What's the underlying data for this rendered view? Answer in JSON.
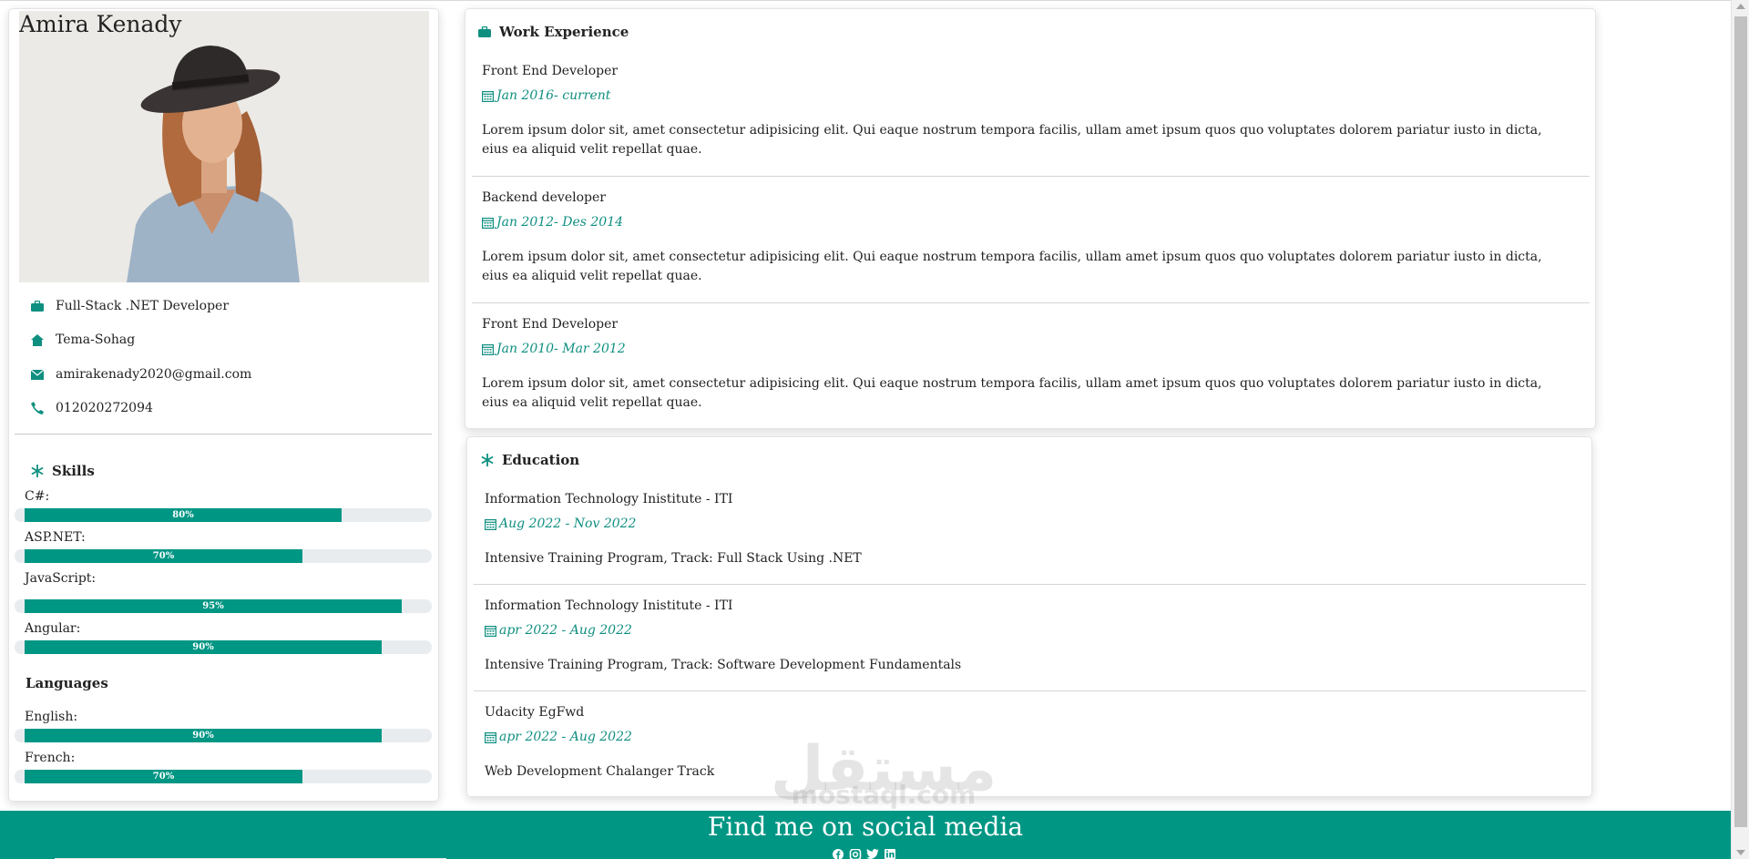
{
  "profile": {
    "name": "Amira Kenady",
    "job": "Full-Stack .NET Developer",
    "location": "Tema-Sohag",
    "email": "amirakenady2020@gmail.com",
    "phone": "012020272094"
  },
  "skills": {
    "title": "Skills",
    "items": [
      {
        "label": "C#:",
        "percent_text": "80%",
        "level": 80
      },
      {
        "label": "ASP.NET:",
        "percent_text": "70%",
        "level": 70
      },
      {
        "label": "JavaScript:",
        "percent_text": "95%",
        "level": 95
      },
      {
        "label": "Angular:",
        "percent_text": "90%",
        "level": 90
      }
    ]
  },
  "languages": {
    "title": "Languages",
    "items": [
      {
        "label": "English:",
        "percent_text": "90%",
        "level": 90
      },
      {
        "label": "French:",
        "percent_text": "70%",
        "level": 70
      }
    ]
  },
  "work": {
    "title": "Work Experience",
    "items": [
      {
        "title": "Front End Developer",
        "date": "Jan 2016- current",
        "desc": "Lorem ipsum dolor sit, amet consectetur adipisicing elit. Qui eaque nostrum tempora facilis, ullam amet ipsum quos quo voluptates dolorem pariatur iusto in dicta, eius ea aliquid velit repellat quae."
      },
      {
        "title": "Backend developer",
        "date": "Jan 2012- Des 2014",
        "desc": "Lorem ipsum dolor sit, amet consectetur adipisicing elit. Qui eaque nostrum tempora facilis, ullam amet ipsum quos quo voluptates dolorem pariatur iusto in dicta, eius ea aliquid velit repellat quae."
      },
      {
        "title": "Front End Developer",
        "date": "Jan 2010- Mar 2012",
        "desc": "Lorem ipsum dolor sit, amet consectetur adipisicing elit. Qui eaque nostrum tempora facilis, ullam amet ipsum quos quo voluptates dolorem pariatur iusto in dicta, eius ea aliquid velit repellat quae."
      }
    ]
  },
  "education": {
    "title": "Education",
    "items": [
      {
        "title": "Information Technology Inistitute - ITI",
        "date": "Aug 2022 - Nov 2022",
        "desc": "Intensive Training Program, Track: Full Stack Using .NET"
      },
      {
        "title": "Information Technology Inistitute - ITI",
        "date": "apr 2022 - Aug 2022",
        "desc": "Intensive Training Program, Track: Software Development Fundamentals"
      },
      {
        "title": "Udacity EgFwd",
        "date": "apr 2022 - Aug 2022",
        "desc": "Web Development Chalanger Track"
      }
    ]
  },
  "footer": {
    "title": "Find me on social media"
  },
  "watermark": {
    "arabic": "مستقل",
    "latin": "mostaql.com"
  },
  "colors": {
    "accent": "#009684",
    "accent_text": "#0f8f80"
  },
  "icons": {
    "job": "briefcase-icon",
    "location": "home-icon",
    "email": "envelope-icon",
    "phone": "phone-icon",
    "skills": "asterisk-icon",
    "work": "briefcase-icon",
    "education": "asterisk-icon",
    "date": "calendar-icon",
    "social": [
      "facebook-icon",
      "instagram-icon",
      "twitter-icon",
      "linkedin-icon"
    ]
  }
}
